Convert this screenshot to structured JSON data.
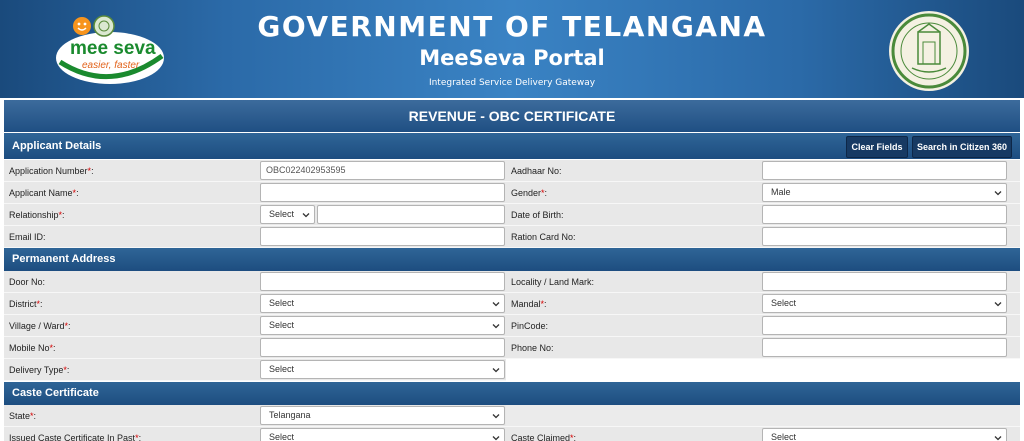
{
  "header": {
    "govt_title": "GOVERNMENT OF TELANGANA",
    "portal_title": "MeeSeva Portal",
    "tagline": "Integrated Service Delivery Gateway",
    "logo_left": {
      "text": "mee seva",
      "tagline": "easier, faster",
      "icon": "meeseva-logo"
    },
    "logo_right": {
      "icon": "telangana-emblem"
    }
  },
  "form": {
    "title": "REVENUE - OBC CERTIFICATE"
  },
  "applicant": {
    "section_title": "Applicant Details",
    "clear_fields_label": "Clear Fields",
    "search_citizen_label": "Search in Citizen 360",
    "application_number_label": "Application Number",
    "application_number_value": "OBC022402953595",
    "aadhaar_label": "Aadhaar No:",
    "applicant_name_label": "Applicant Name",
    "gender_label": "Gender",
    "gender_value": "Male",
    "relationship_label": "Relationship",
    "relationship_value": "Select",
    "dob_label": "Date of Birth:",
    "email_label": "Email ID:",
    "ration_label": "Ration Card No:"
  },
  "address": {
    "section_title": "Permanent Address",
    "door_label": "Door No:",
    "locality_label": "Locality / Land Mark:",
    "district_label": "District",
    "district_value": "Select",
    "mandal_label": "Mandal",
    "mandal_value": "Select",
    "village_label": "Village / Ward",
    "village_value": "Select",
    "pincode_label": "PinCode:",
    "mobile_label": "Mobile No",
    "phone_label": "Phone No:",
    "delivery_label": "Delivery Type",
    "delivery_value": "Select"
  },
  "caste": {
    "section_title": "Caste Certificate",
    "state_label": "State",
    "state_value": "Telangana",
    "issued_label": "Issued Caste Certificate In Past",
    "issued_value": "Select",
    "claimed_label": "Caste Claimed",
    "claimed_value": "Select"
  },
  "colors": {
    "header_blue": "#2b6aa8",
    "section_blue": "#1d4d80",
    "button_navy": "#173a63",
    "label_bg": "#e8e8e8",
    "required_red": "#d40000"
  }
}
